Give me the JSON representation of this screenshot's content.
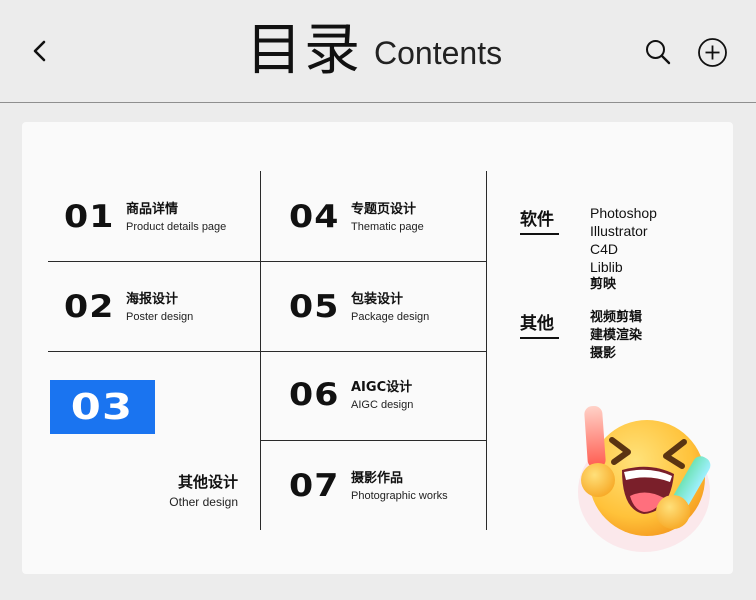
{
  "header": {
    "title_zh": "目录",
    "title_en": "Contents"
  },
  "sections": [
    {
      "num": "01",
      "zh": "商品详情",
      "en": "Product details page"
    },
    {
      "num": "02",
      "zh": "海报设计",
      "en": "Poster design"
    },
    {
      "num": "03",
      "zh": "其他设计",
      "en": "Other design"
    },
    {
      "num": "04",
      "zh": "专题页设计",
      "en": "Thematic page"
    },
    {
      "num": "05",
      "zh": "包装设计",
      "en": "Package design"
    },
    {
      "num": "06",
      "zh": "AIGC设计",
      "en": "AIGC design"
    },
    {
      "num": "07",
      "zh": "摄影作品",
      "en": "Photographic works"
    }
  ],
  "software": {
    "title": "软件",
    "items": [
      "Photoshop",
      "Illustrator",
      "C4D",
      "Liblib",
      "剪映"
    ]
  },
  "other": {
    "title": "其他",
    "items": [
      "视频剪辑",
      "建模渲染",
      "摄影"
    ]
  },
  "colors": {
    "accent": "#1a74f0",
    "background": "#ececec",
    "card": "#fafafa"
  },
  "icons": {
    "back": "chevron-left-icon",
    "search": "search-icon",
    "add": "plus-circle-icon",
    "decoration": "laughing-emoji-icon"
  }
}
